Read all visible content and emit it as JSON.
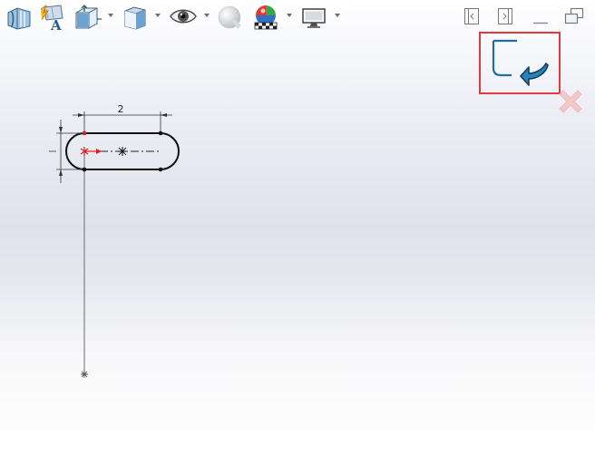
{
  "toolbar": {
    "items": [
      {
        "name": "section-view",
        "icon": "section-view-icon",
        "dropdown": false
      },
      {
        "name": "dynamic-annotation",
        "icon": "dynamic-annotation-icon",
        "dropdown": false
      },
      {
        "name": "view-orientation",
        "icon": "view-orientation-icon",
        "dropdown": true
      },
      {
        "name": "display-style",
        "icon": "display-style-icon",
        "dropdown": true
      },
      {
        "name": "hide-show-items",
        "icon": "hide-show-eye-icon",
        "dropdown": true
      },
      {
        "name": "edit-appearance",
        "icon": "appearance-sphere-icon",
        "dropdown": false
      },
      {
        "name": "apply-scene",
        "icon": "scene-icon",
        "dropdown": true
      },
      {
        "name": "view-settings",
        "icon": "monitor-icon",
        "dropdown": true
      }
    ]
  },
  "window_controls": [
    "tile-left-icon",
    "tile-right-icon",
    "minimize-icon",
    "restore-icon"
  ],
  "confirmation_corner": {
    "exit_sketch_icon": "exit-sketch-icon",
    "cancel_icon": "cancel-x-icon",
    "highlight_color": "#e0393e",
    "accent_color": "#1f6f9e"
  },
  "sketch": {
    "dimension_value": "2",
    "line_color": "#111111",
    "origin_color": "#e02020"
  }
}
